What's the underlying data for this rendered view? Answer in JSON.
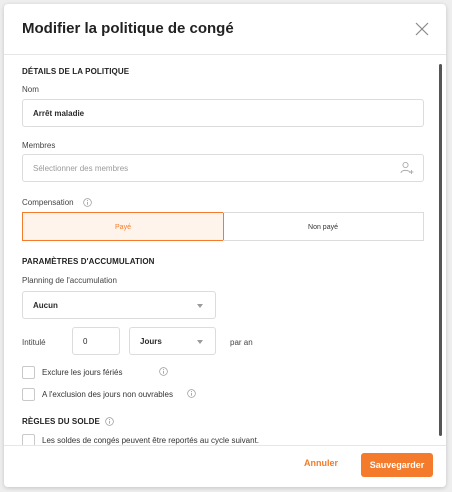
{
  "modal": {
    "title": "Modifier la politique de congé"
  },
  "details": {
    "section_title": "DÉTAILS DE LA POLITIQUE",
    "name_label": "Nom",
    "name_value": "Arrêt maladie",
    "members_label": "Membres",
    "members_placeholder": "Sélectionner des membres",
    "compensation_label": "Compensation",
    "compensation_options": [
      "Payé",
      "Non payé"
    ],
    "compensation_selected": "Payé"
  },
  "accrual": {
    "section_title": "PARAMÈTRES D'ACCUMULATION",
    "schedule_label": "Planning de l'accumulation",
    "schedule_value": "Aucun",
    "interval_label": "Intitulé",
    "interval_value": "0",
    "unit_value": "Jours",
    "per_label": "par an",
    "exclude_holidays_label": "Exclure les jours fériés",
    "exclude_nonworking_label": "A l'exclusion des jours non ouvrables"
  },
  "balance": {
    "section_title": "RÈGLES DU SOLDE",
    "carryover_label": "Les soldes de congés peuvent être reportés au cycle suivant."
  },
  "footer": {
    "cancel_label": "Annuler",
    "save_label": "Sauvegarder"
  },
  "colors": {
    "accent": "#f37b2b"
  }
}
